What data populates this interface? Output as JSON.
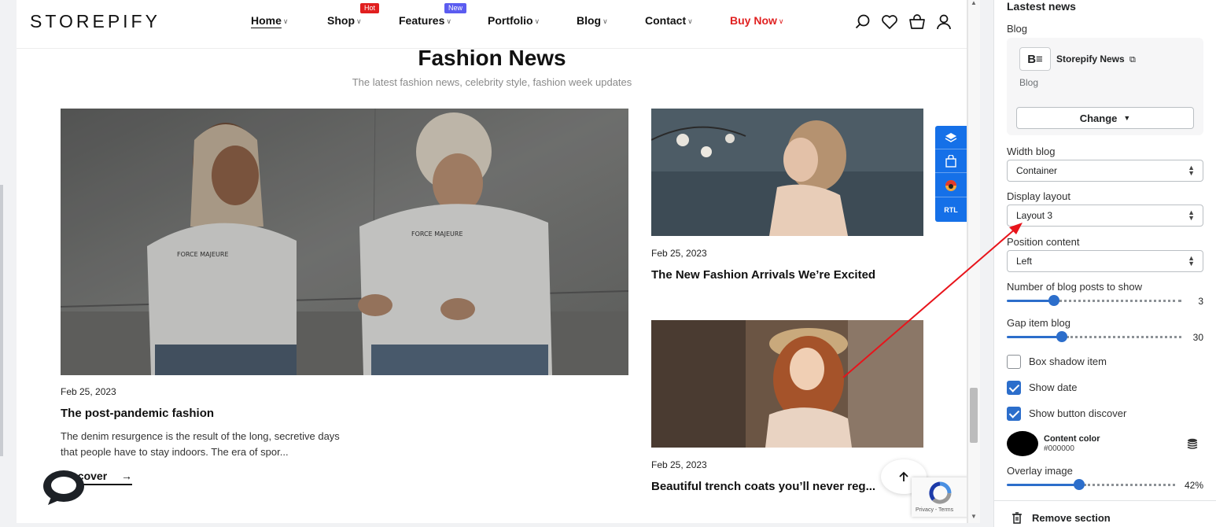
{
  "header": {
    "logo": "STOREPIFY",
    "nav": [
      {
        "label": "Home",
        "badge": ""
      },
      {
        "label": "Shop",
        "badge": "Hot"
      },
      {
        "label": "Features",
        "badge": "New"
      },
      {
        "label": "Portfolio",
        "badge": ""
      },
      {
        "label": "Blog",
        "badge": ""
      },
      {
        "label": "Contact",
        "badge": ""
      },
      {
        "label": "Buy Now",
        "badge": ""
      }
    ],
    "icons": [
      "search-icon",
      "heart-icon",
      "cart-icon",
      "user-icon"
    ]
  },
  "section": {
    "title": "Fashion News",
    "subtitle": "The latest fashion news, celebrity style, fashion week updates"
  },
  "posts": [
    {
      "date": "Feb 25, 2023",
      "title": "The post-pandemic fashion",
      "excerpt_line1": "The denim resurgence is the result of the long, secretive days",
      "excerpt_line2": "that people have to stay indoors. The era of spor...",
      "cta": "Discover"
    },
    {
      "date": "Feb 25, 2023",
      "title": "The New Fashion Arrivals We’re Excited"
    },
    {
      "date": "Feb 25, 2023",
      "title": "Beautiful trench coats you’ll never reg..."
    }
  ],
  "float_toolbar": {
    "rtl_label": "RTL",
    "icons": [
      "layers-icon",
      "bag-icon",
      "color-palette-icon"
    ]
  },
  "recaptcha": {
    "text": "Privacy - Terms"
  },
  "panel": {
    "heading": "Lastest news",
    "blog_label": "Blog",
    "blog_name": "Storepify News",
    "blog_sub": "Blog",
    "change_label": "Change",
    "width_label": "Width blog",
    "width_value": "Container",
    "layout_label": "Display layout",
    "layout_value": "Layout 3",
    "position_label": "Position content",
    "position_value": "Left",
    "posts_label": "Number of blog posts to show",
    "posts_value": "3",
    "gap_label": "Gap item blog",
    "gap_value": "30",
    "box_shadow_label": "Box shadow item",
    "box_shadow_checked": false,
    "show_date_label": "Show date",
    "show_date_checked": true,
    "show_discover_label": "Show button discover",
    "show_discover_checked": true,
    "content_color_label": "Content color",
    "content_color_value": "#000000",
    "overlay_label": "Overlay image",
    "overlay_value": "42%",
    "remove_label": "Remove section"
  },
  "colors": {
    "accent": "#2c6ecb",
    "float_bar": "#1570e8",
    "buy_now": "#e02121",
    "hot_badge": "#e11f1f",
    "new_badge": "#5b5cf0",
    "annotation_arrow": "#e8141b"
  }
}
